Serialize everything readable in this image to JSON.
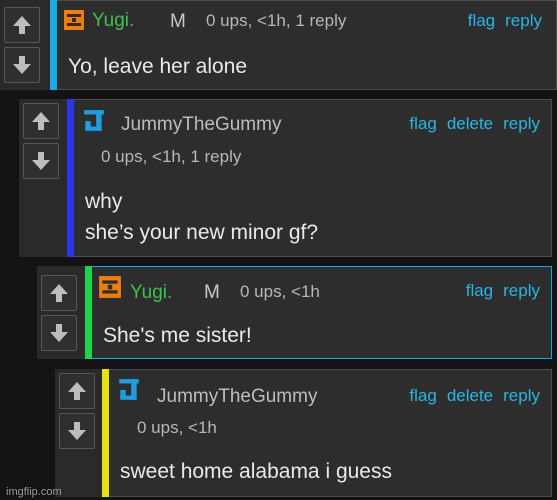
{
  "colors": {
    "link": "#29b6e6",
    "c1_bar": "#1ba9e3",
    "c2_bar": "#2c36e8",
    "c3_bar": "#1bd34e",
    "c4_bar": "#e5e316",
    "yugi_name": "#3fc14f",
    "yugi_avatar": "#f07d10",
    "jummy_avatar": "#1e9de0"
  },
  "comments": [
    {
      "username": "Yugi.",
      "badge": "M",
      "meta": "0 ups, <1h, 1 reply",
      "actions": [
        "flag",
        "reply"
      ],
      "text": [
        "Yo, leave her alone"
      ],
      "avatar_icon": "yugi-avatar-icon"
    },
    {
      "username": "JummyTheGummy",
      "badge": "",
      "meta": "0 ups, <1h, 1 reply",
      "actions": [
        "flag",
        "delete",
        "reply"
      ],
      "text": [
        "why",
        "she’s your new minor gf?"
      ],
      "avatar_icon": "jummy-avatar-icon"
    },
    {
      "username": "Yugi.",
      "badge": "M",
      "meta": "0 ups, <1h",
      "actions": [
        "flag",
        "reply"
      ],
      "text": [
        "She's me sister!"
      ],
      "avatar_icon": "yugi-avatar-icon"
    },
    {
      "username": "JummyTheGummy",
      "badge": "",
      "meta": "0 ups, <1h",
      "actions": [
        "flag",
        "delete",
        "reply"
      ],
      "text": [
        "sweet home alabama i guess"
      ],
      "avatar_icon": "jummy-avatar-icon"
    }
  ],
  "icons": {
    "upvote": "arrow-up-icon",
    "downvote": "arrow-down-icon"
  },
  "watermark": "imgflip.com"
}
